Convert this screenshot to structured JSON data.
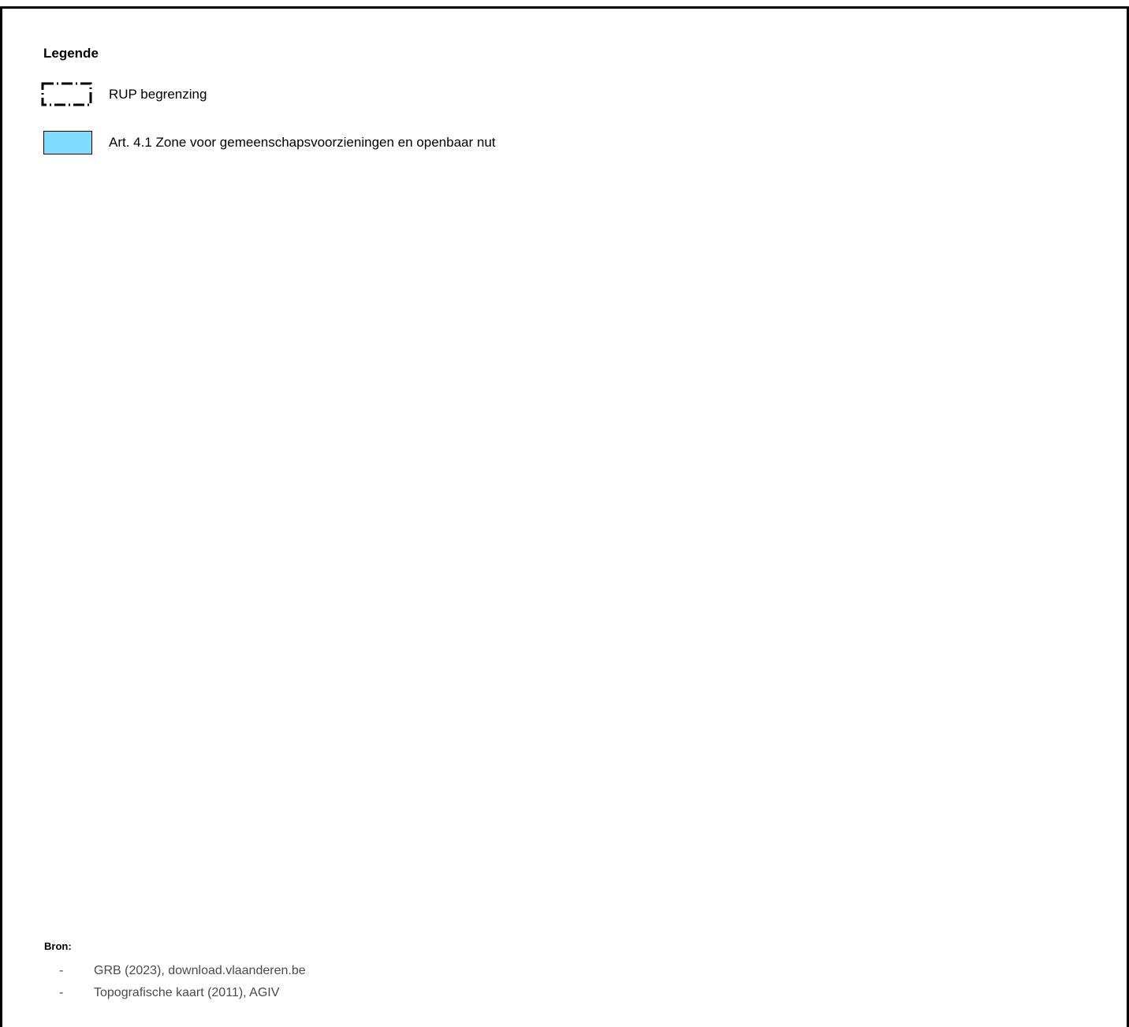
{
  "legend": {
    "title": "Legende",
    "items": [
      {
        "symbol": "dashed-outline",
        "label": "RUP begrenzing"
      },
      {
        "symbol": "filled-rectangle",
        "color": "#7fdbff",
        "label": "Art. 4.1 Zone voor gemeenschapsvoorzieningen en openbaar nut"
      }
    ]
  },
  "sources": {
    "title": "Bron:",
    "items": [
      {
        "bullet": "-",
        "text": "GRB (2023), download.vlaanderen.be"
      },
      {
        "bullet": "-",
        "text": "Topografische kaart (2011), AGIV"
      }
    ]
  }
}
